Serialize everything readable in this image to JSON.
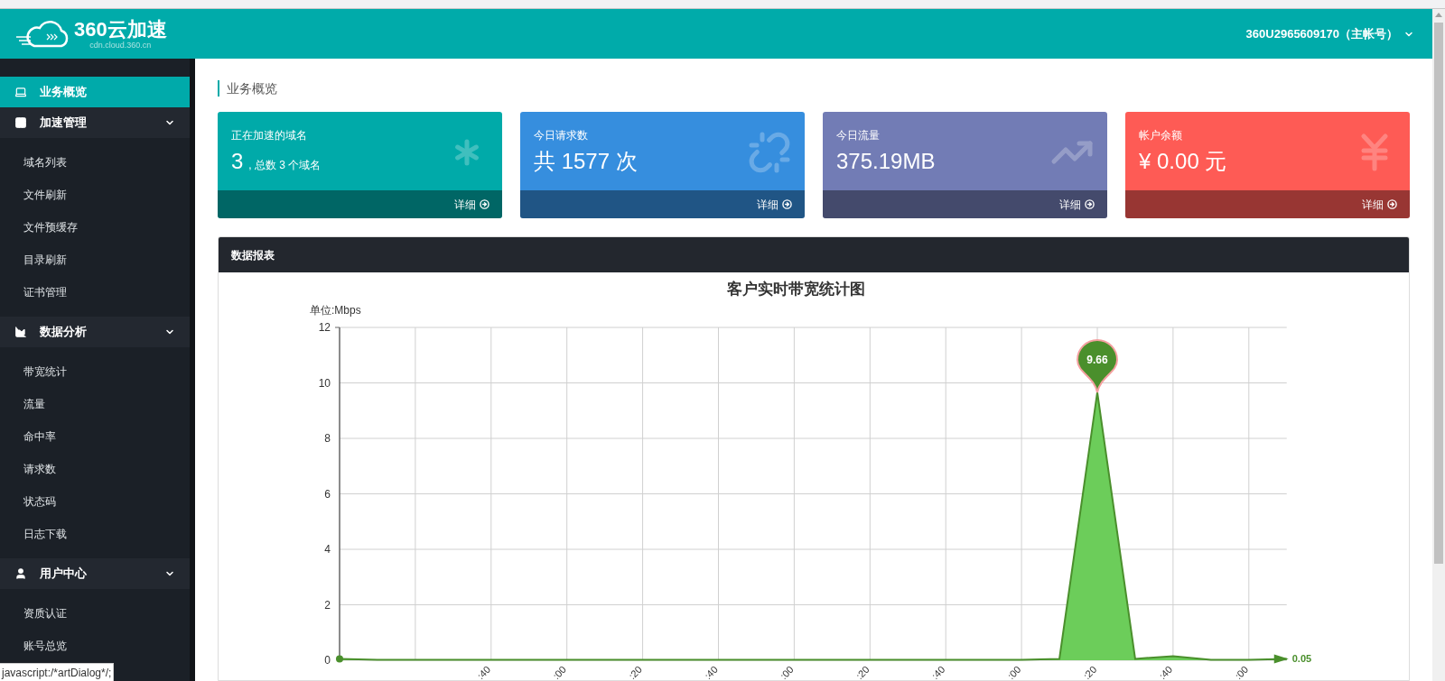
{
  "header": {
    "logo_text": "360云加速",
    "logo_subtext": "cdn.cloud.360.cn",
    "account": "360U2965609170（主帐号）"
  },
  "sidebar": {
    "items": [
      {
        "kind": "link",
        "label": "业务概览",
        "selected": true
      },
      {
        "kind": "group",
        "label": "加速管理",
        "expanded": true,
        "children": [
          {
            "label": "域名列表",
            "selected": false
          },
          {
            "label": "文件刷新",
            "selected": false
          },
          {
            "label": "文件预缓存",
            "selected": false
          },
          {
            "label": "目录刷新",
            "selected": false
          },
          {
            "label": "证书管理",
            "selected": false
          }
        ]
      },
      {
        "kind": "group",
        "label": "数据分析",
        "expanded": true,
        "children": [
          {
            "label": "带宽统计",
            "selected": false
          },
          {
            "label": "流量",
            "selected": false
          },
          {
            "label": "命中率",
            "selected": false
          },
          {
            "label": "请求数",
            "selected": false
          },
          {
            "label": "状态码",
            "selected": false
          },
          {
            "label": "日志下载",
            "selected": false
          }
        ]
      },
      {
        "kind": "group",
        "label": "用户中心",
        "expanded": true,
        "children": [
          {
            "label": "资质认证",
            "selected": false
          },
          {
            "label": "账号总览",
            "selected": false
          }
        ]
      }
    ]
  },
  "page_title": "业务概览",
  "cards": [
    {
      "label": "正在加速的域名",
      "value": "3",
      "note": ", 总数 3 个域名",
      "link": "详细",
      "color": "#00aaa9"
    },
    {
      "label": "今日请求数",
      "value": "共 1577 次",
      "link": "详细",
      "color": "#368ede"
    },
    {
      "label": "今日流量",
      "value": "375.19MB",
      "link": "详细",
      "color": "#727cb5"
    },
    {
      "label": "帐户余额",
      "value": "¥ 0.00 元",
      "link": "详细",
      "color": "#fe5b55"
    }
  ],
  "report": {
    "title": "数据报表",
    "chart_data": {
      "type": "area",
      "title": "客户实时带宽统计图",
      "ylabel": "单位:Mbps",
      "categories": [
        null,
        null,
        null,
        null,
        ":40",
        null,
        ":00",
        null,
        ":20",
        null,
        ":40",
        null,
        ":00",
        null,
        ":20",
        null,
        ":40",
        null,
        ":00",
        null,
        ":20",
        null,
        ":40",
        null,
        ":00",
        null
      ],
      "series": [
        {
          "color": "#4a8f2c",
          "values": [
            0.05,
            0.02,
            0.02,
            0.02,
            0.02,
            0.02,
            0.02,
            0.02,
            0.02,
            0.02,
            0.02,
            0.02,
            0.02,
            0.02,
            0.02,
            0.02,
            0.02,
            0.02,
            0.02,
            0.05,
            9.66,
            0.05,
            0.15,
            0.02,
            0.02,
            0.05
          ]
        }
      ],
      "ylim": [
        0,
        12
      ],
      "yticks": [
        0,
        2,
        4,
        6,
        8,
        10,
        12
      ],
      "grid": true,
      "annotations": [
        {
          "y": 9.66,
          "text": "9.66"
        },
        "0.05"
      ]
    }
  },
  "status_bar": "javascript:/*artDialog*/;"
}
